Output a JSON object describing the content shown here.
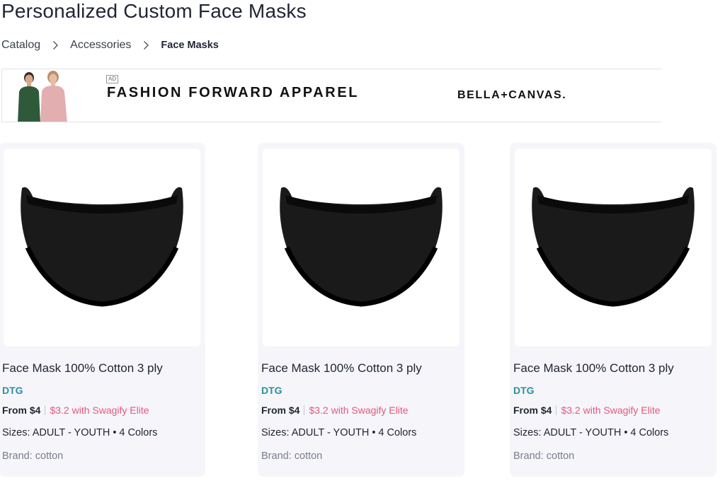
{
  "page": {
    "title": "Personalized Custom Face Masks"
  },
  "breadcrumb": {
    "items": [
      "Catalog",
      "Accessories",
      "Face Masks"
    ]
  },
  "ad": {
    "badge": "AD",
    "headline": "FASHION FORWARD APPAREL",
    "brand": "BELLA+CANVAS."
  },
  "products": [
    {
      "name": "Face Mask 100% Cotton 3 ply",
      "print_method": "DTG",
      "price": "From $4",
      "elite_price": "$3.2 with Swagify Elite",
      "sizes": "Sizes: ADULT - YOUTH • 4 Colors",
      "brand": "Brand: cotton"
    },
    {
      "name": "Face Mask 100% Cotton 3 ply",
      "print_method": "DTG",
      "price": "From $4",
      "elite_price": "$3.2 with Swagify Elite",
      "sizes": "Sizes: ADULT - YOUTH • 4 Colors",
      "brand": "Brand: cotton"
    },
    {
      "name": "Face Mask 100% Cotton 3 ply",
      "print_method": "DTG",
      "price": "From $4",
      "elite_price": "$3.2 with Swagify Elite",
      "sizes": "Sizes: ADULT - YOUTH • 4 Colors",
      "brand": "Brand: cotton"
    }
  ],
  "colors": {
    "elite": "#e8587a",
    "print_tag": "#2c8f9c",
    "card_bg": "#f5f5fa"
  },
  "icons": {
    "breadcrumb_separator": "chevron-right-icon"
  }
}
